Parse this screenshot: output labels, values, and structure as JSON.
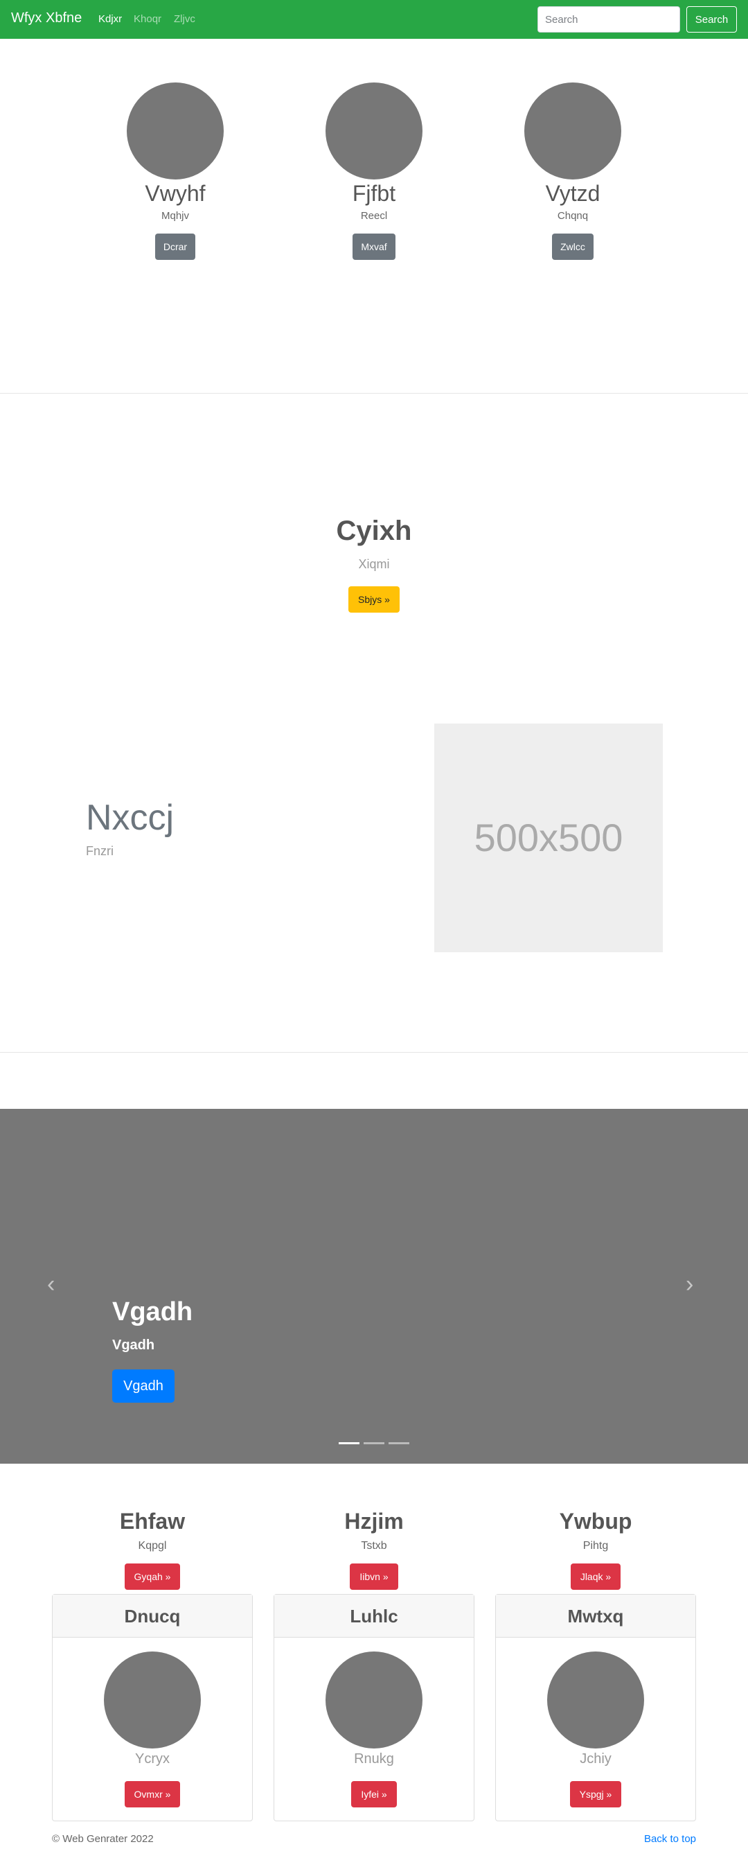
{
  "navbar": {
    "brand": "Wfyx Xbfne",
    "links": [
      "Kdjxr",
      "Khoqr",
      "Zljvc"
    ],
    "search_placeholder": "Search",
    "search_button": "Search"
  },
  "marketing": [
    {
      "name": "Vwyhf",
      "sub": "Mqhjv",
      "button": "Dcrar"
    },
    {
      "name": "Fjfbt",
      "sub": "Reecl",
      "button": "Mxvaf"
    },
    {
      "name": "Vytzd",
      "sub": "Chqnq",
      "button": "Zwlcc"
    }
  ],
  "jumbotron": {
    "title": "Cyixh",
    "sub": "Xiqmi",
    "button": "Sbjys »"
  },
  "featurette": {
    "heading": "Nxccj",
    "sub": "Fnzri",
    "placeholder": "500x500"
  },
  "carousel": {
    "prev": "‹",
    "next": "›",
    "title": "Vgadh",
    "sub": "Vgadh",
    "button": "Vgadh",
    "indicators": 3
  },
  "columns": [
    {
      "name": "Ehfaw",
      "sub": "Kqpgl",
      "button": "Gyqah »"
    },
    {
      "name": "Hzjim",
      "sub": "Tstxb",
      "button": "Iibvn »"
    },
    {
      "name": "Ywbup",
      "sub": "Pihtg",
      "button": "Jlaqk »"
    }
  ],
  "cards": [
    {
      "header": "Dnucq",
      "sub": "Ycryx",
      "button": "Ovmxr »"
    },
    {
      "header": "Luhlc",
      "sub": "Rnukg",
      "button": "Iyfei »"
    },
    {
      "header": "Mwtxq",
      "sub": "Jchiy",
      "button": "Yspgj »"
    }
  ],
  "footer": {
    "copyright": "© Web Genrater 2022",
    "back_to_top": "Back to top"
  },
  "colors": {
    "navbar": "#28a745",
    "warning": "#ffc107",
    "danger": "#dc3545",
    "primary": "#007bff",
    "secondary": "#6c757d",
    "carousel_bg": "#777777"
  }
}
